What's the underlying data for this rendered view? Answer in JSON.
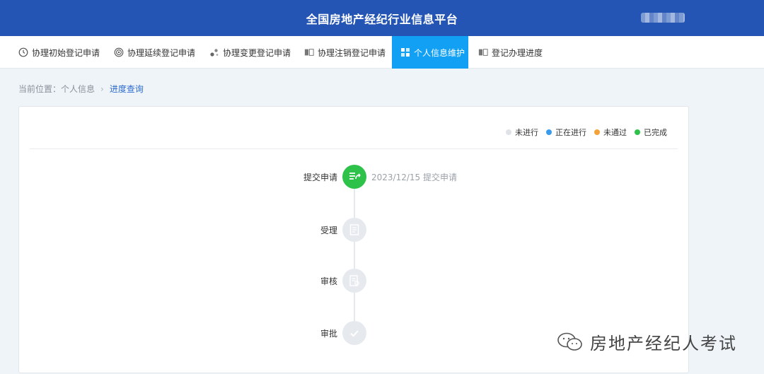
{
  "header": {
    "title": "全国房地产经纪行业信息平台"
  },
  "nav": [
    {
      "label": "协理初始登记申请",
      "icon": "clock-icon",
      "active": false
    },
    {
      "label": "协理延续登记申请",
      "icon": "target-icon",
      "active": false
    },
    {
      "label": "协理变更登记申请",
      "icon": "dots-icon",
      "active": false
    },
    {
      "label": "协理注销登记申请",
      "icon": "book-icon",
      "active": false
    },
    {
      "label": "个人信息维护",
      "icon": "grid-icon",
      "active": true
    },
    {
      "label": "登记办理进度",
      "icon": "book-icon",
      "active": false
    }
  ],
  "breadcrumb": {
    "prefix": "当前位置：",
    "parent": "个人信息",
    "separator": "›",
    "current": "进度查询"
  },
  "legend": [
    {
      "label": "未进行",
      "color": "#dfe3e8"
    },
    {
      "label": "正在进行",
      "color": "#3a9bea"
    },
    {
      "label": "未通过",
      "color": "#f5a23a"
    },
    {
      "label": "已完成",
      "color": "#2ec24b"
    }
  ],
  "steps": [
    {
      "label": "提交申请",
      "note": "2023/12/15 提交申请",
      "status": "done",
      "icon": "submit-icon"
    },
    {
      "label": "受理",
      "note": "",
      "status": "pending",
      "icon": "document-icon"
    },
    {
      "label": "审核",
      "note": "",
      "status": "pending",
      "icon": "review-icon"
    },
    {
      "label": "审批",
      "note": "",
      "status": "pending",
      "icon": "check-icon"
    }
  ],
  "watermark": {
    "text": "房地产经纪人考试"
  },
  "colors": {
    "header": "#2455b4",
    "active_tab": "#12a0f5",
    "done": "#2ec24b",
    "pending": "#e6e9ee"
  }
}
